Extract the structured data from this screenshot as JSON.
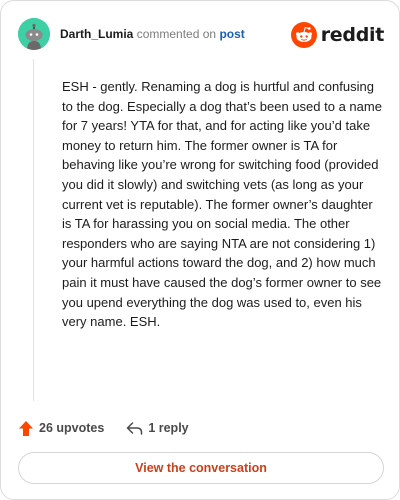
{
  "header": {
    "username": "Darth_Lumia",
    "commented_on": "commented on",
    "post_link": "post",
    "brand": "reddit"
  },
  "comment": {
    "body": "ESH - gently. Renaming a dog is hurtful and confusing to the dog. Especially a dog that’s been used to a name for 7 years! YTA for that, and for acting like you’d take money to return him. The former owner is TA for behaving like you’re wrong for switching food (provided you did it slowly) and switching vets (as long as your current vet is reputable). The former owner’s daughter is TA for harassing you on social media. The other responders who are saying NTA are not considering 1) your harmful actions toward the dog, and 2) how much pain it must have caused the dog’s former owner to see you upend everything the dog was used to, even his very name. ESH."
  },
  "actions": {
    "upvotes": "26 upvotes",
    "replies": "1 reply",
    "upvote_icon": "upvote-arrow-icon",
    "reply_icon": "reply-arrow-icon"
  },
  "footer": {
    "view_label": "View the conversation"
  },
  "colors": {
    "avatar_bg": "#3ecfa4",
    "reddit_orange": "#ff4500",
    "link_blue": "#1a5fb4",
    "button_text": "#c9401b"
  }
}
